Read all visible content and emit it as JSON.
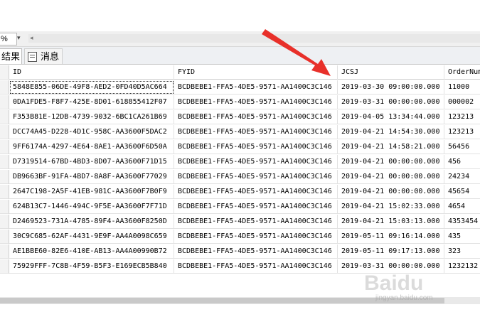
{
  "toolbar": {
    "zoom_value": "%",
    "zoom_arrow": "▾",
    "scroll_left_arrow": "◂"
  },
  "tabs": [
    {
      "label": "结果"
    },
    {
      "label": "消息"
    }
  ],
  "grid": {
    "columns": [
      "ID",
      "FYID",
      "JCSJ",
      "OrderNum"
    ],
    "rows": [
      [
        "5848E855-06DE-49F8-AED2-0FD40D5AC664",
        "BCDBEBE1-FFA5-4DE5-9571-AA1400C3C146",
        "2019-03-30 09:00:00.000",
        "11000"
      ],
      [
        "0DA1FDE5-F8F7-425E-8D01-618855412F07",
        "BCDBEBE1-FFA5-4DE5-9571-AA1400C3C146",
        "2019-03-31 00:00:00.000",
        "000002"
      ],
      [
        "F353B81E-12DB-4739-9032-6BC1CA261B69",
        "BCDBEBE1-FFA5-4DE5-9571-AA1400C3C146",
        "2019-04-05 13:34:44.000",
        "123213"
      ],
      [
        "DCC74A45-D228-4D1C-958C-AA3600F5DAC2",
        "BCDBEBE1-FFA5-4DE5-9571-AA1400C3C146",
        "2019-04-21 14:54:30.000",
        "123213"
      ],
      [
        "9FF6174A-4297-4E64-8AE1-AA3600F6D50A",
        "BCDBEBE1-FFA5-4DE5-9571-AA1400C3C146",
        "2019-04-21 14:58:21.000",
        "56456"
      ],
      [
        "D7319514-67BD-4BD3-8D07-AA3600F71D15",
        "BCDBEBE1-FFA5-4DE5-9571-AA1400C3C146",
        "2019-04-21 00:00:00.000",
        "456"
      ],
      [
        "DB9663BF-91FA-4BD7-8A8F-AA3600F77029",
        "BCDBEBE1-FFA5-4DE5-9571-AA1400C3C146",
        "2019-04-21 00:00:00.000",
        "24234"
      ],
      [
        "2647C198-2A5F-41EB-981C-AA3600F7B0F9",
        "BCDBEBE1-FFA5-4DE5-9571-AA1400C3C146",
        "2019-04-21 00:00:00.000",
        "45654"
      ],
      [
        "624B13C7-1446-494C-9F5E-AA3600F7F71D",
        "BCDBEBE1-FFA5-4DE5-9571-AA1400C3C146",
        "2019-04-21 15:02:33.000",
        "4654"
      ],
      [
        "D2469523-731A-4785-89F4-AA3600F8250D",
        "BCDBEBE1-FFA5-4DE5-9571-AA1400C3C146",
        "2019-04-21 15:03:13.000",
        "4353454"
      ],
      [
        "30C9C685-62AF-4431-9E9F-AA4A0098C659",
        "BCDBEBE1-FFA5-4DE5-9571-AA1400C3C146",
        "2019-05-11 09:16:14.000",
        "435"
      ],
      [
        "AE1BBE60-82E6-410E-AB13-AA4A00990B72",
        "BCDBEBE1-FFA5-4DE5-9571-AA1400C3C146",
        "2019-05-11 09:17:13.000",
        "323"
      ],
      [
        "75929FFF-7C8B-4F59-B5F3-E169ECB5B840",
        "BCDBEBE1-FFA5-4DE5-9571-AA1400C3C146",
        "2019-03-31 00:00:00.000",
        "1232132"
      ]
    ]
  },
  "annotation": {
    "arrow_color": "#e8302a"
  },
  "watermark": {
    "text": "Baidu",
    "url": "jingyan.baidu.com"
  }
}
